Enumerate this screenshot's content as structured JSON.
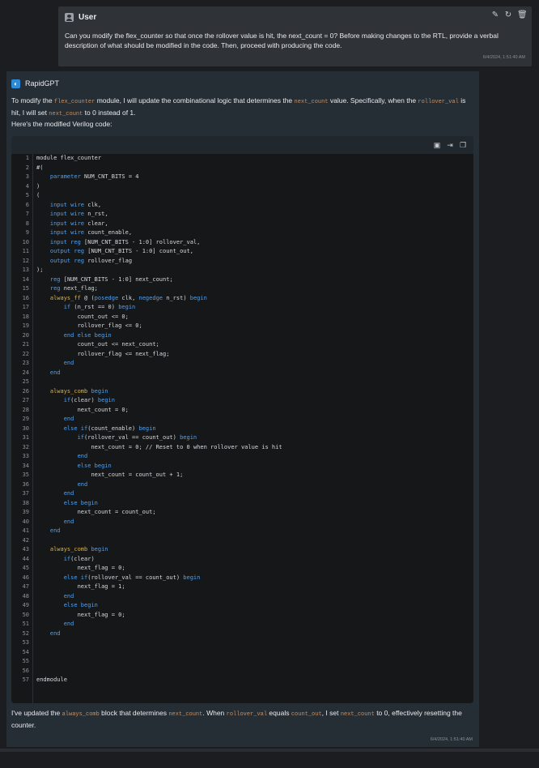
{
  "user_message": {
    "author": "User",
    "text": "Can you modify the flex_counter so that once the rollover value is hit, the next_count = 0? Before making changes to the RTL, provide a verbal description of what should be modified in the code. Then, proceed with producing the code.",
    "timestamp": "6/4/2024, 1:51:40 AM",
    "actions": [
      "edit-icon",
      "regenerate-icon",
      "delete-icon"
    ]
  },
  "assistant_message": {
    "author": "RapidGPT",
    "intro_1": "To modify the ",
    "intro_code_1": "flex_counter",
    "intro_2": " module, I will update the combinational logic that determines the ",
    "intro_code_2": "next_count",
    "intro_3": " value. Specifically, when the ",
    "intro_code_3": "rollover_val",
    "intro_4": " is hit, I will set ",
    "intro_code_4": "next_count",
    "intro_5": " to 0 instead of 1.",
    "intro_line_2": "Here's the modified Verilog code:",
    "code_actions": [
      "save-icon",
      "insert-icon",
      "copy-icon"
    ],
    "code_lines": [
      "module flex_counter",
      "#(",
      "    parameter NUM_CNT_BITS = 4",
      ")",
      "(",
      "    input wire clk,",
      "    input wire n_rst,",
      "    input wire clear,",
      "    input wire count_enable,",
      "    input reg [NUM_CNT_BITS - 1:0] rollover_val,",
      "    output reg [NUM_CNT_BITS - 1:0] count_out,",
      "    output reg rollover_flag",
      ");",
      "    reg [NUM_CNT_BITS - 1:0] next_count;",
      "    reg next_flag;",
      "    always_ff @ (posedge clk, negedge n_rst) begin",
      "        if (n_rst == 0) begin",
      "            count_out <= 0;",
      "            rollover_flag <= 0;",
      "        end else begin",
      "            count_out <= next_count;",
      "            rollover_flag <= next_flag;",
      "        end",
      "    end",
      "",
      "    always_comb begin",
      "        if(clear) begin",
      "            next_count = 0;",
      "        end",
      "        else if(count_enable) begin",
      "            if(rollover_val == count_out) begin",
      "                next_count = 0; // Reset to 0 when rollover value is hit",
      "            end",
      "            else begin",
      "                next_count = count_out + 1;",
      "            end",
      "        end",
      "        else begin",
      "            next_count = count_out;",
      "        end",
      "    end",
      "",
      "    always_comb begin",
      "        if(clear)",
      "            next_flag = 0;",
      "        else if(rollover_val == count_out) begin",
      "            next_flag = 1;",
      "        end",
      "        else begin",
      "            next_flag = 0;",
      "        end",
      "    end",
      "",
      "",
      "",
      "",
      "endmodule"
    ],
    "outro_1": "I've updated the ",
    "outro_code_1": "always_comb",
    "outro_2": " block that determines ",
    "outro_code_2": "next_count",
    "outro_3": ". When ",
    "outro_code_3": "rollover_val",
    "outro_4": " equals ",
    "outro_code_4": "count_out",
    "outro_5": ", I set ",
    "outro_code_5": "next_count",
    "outro_6": " to 0, effectively resetting the counter.",
    "timestamp": "6/4/2024, 1:51:40 AM"
  },
  "colors": {
    "background": "#1b1d20",
    "user_card": "#2f3236",
    "assistant_card": "#262e35",
    "code_background": "#151719",
    "keyword": "#4ea1f2",
    "function_keyword": "#d9b24a",
    "inline_code": "#c48f64"
  }
}
